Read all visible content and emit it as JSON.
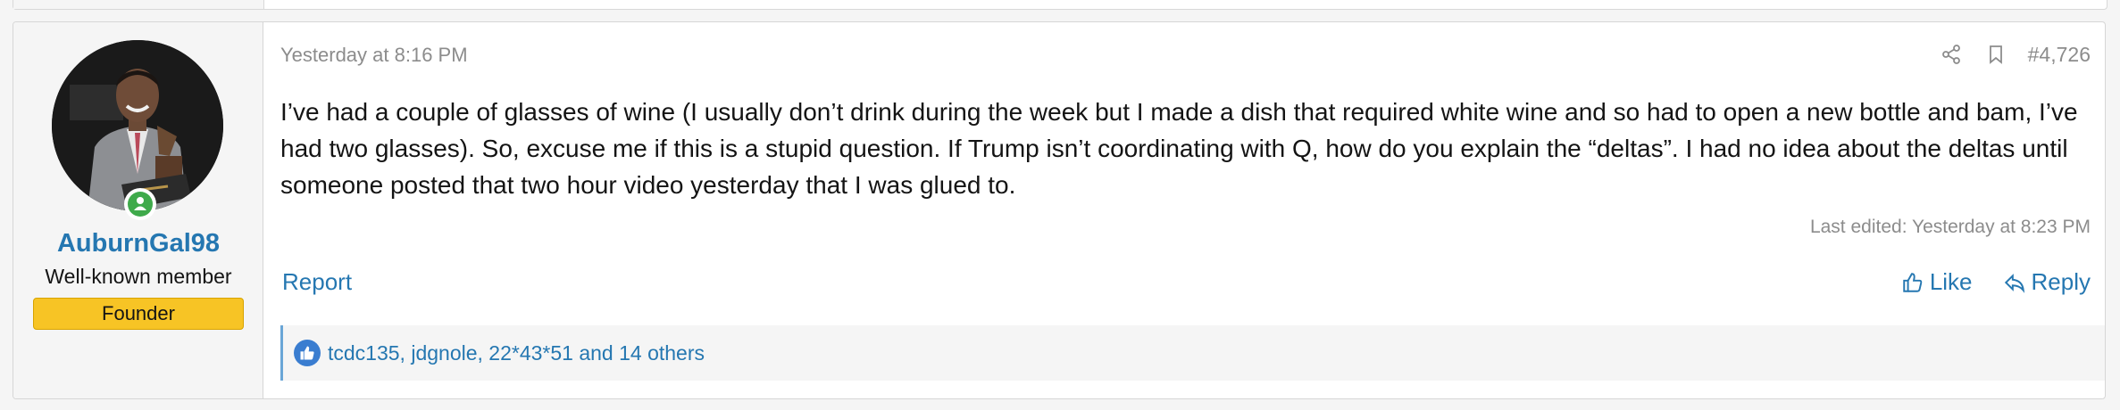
{
  "post": {
    "user": {
      "name": "AuburnGal98",
      "title": "Well-known member",
      "banner": "Founder",
      "online": true
    },
    "date": "Yesterday at 8:16 PM",
    "number": "#4,726",
    "message": "I’ve had a couple of glasses of wine (I usually don’t drink during the week but I made a dish that required white wine and so had to open a new bottle and bam, I’ve had two glasses). So, excuse me if this is a stupid question. If Trump isn’t coordinating with Q, how do you explain the “deltas”. I had no idea about the deltas until someone posted that two hour video yesterday that I was glued to.",
    "last_edited": "Last edited: Yesterday at 8:23 PM",
    "report_label": "Report",
    "like_label": "Like",
    "reply_label": "Reply",
    "reactions_text": "tcdc135, jdgnole, 22*43*51 and 14 others",
    "icons": {
      "share": "share-icon",
      "bookmark": "bookmark-icon",
      "like": "thumbs-up-icon",
      "reply": "reply-icon",
      "reaction": "like-reaction-icon",
      "online": "user-online-icon"
    },
    "colors": {
      "link": "#2577b1",
      "banner": "#f7c425",
      "online": "#3faa4b",
      "reaction_badge": "#3a7dd0"
    }
  }
}
